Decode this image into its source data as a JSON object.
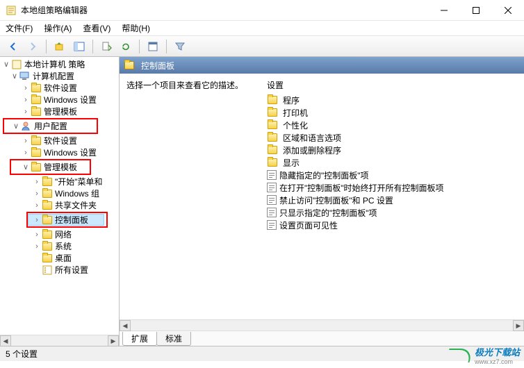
{
  "window": {
    "title": "本地组策略编辑器"
  },
  "menu": {
    "file": "文件(F)",
    "action": "操作(A)",
    "view": "查看(V)",
    "help": "帮助(H)"
  },
  "tree": {
    "root": "本地计算机 策略",
    "computer_config": "计算机配置",
    "cc_software": "软件设置",
    "cc_windows": "Windows 设置",
    "cc_admin": "管理模板",
    "user_config": "用户配置",
    "uc_software": "软件设置",
    "uc_windows": "Windows 设置",
    "uc_admin": "管理模板",
    "uc_startmenu": "\"开始\"菜单和",
    "uc_wincomp": "Windows 组",
    "uc_shared": "共享文件夹",
    "uc_control_panel": "控制面板",
    "uc_network": "网络",
    "uc_system": "系统",
    "uc_desktop": "桌面",
    "uc_all": "所有设置"
  },
  "content": {
    "header": "控制面板",
    "description": "选择一个项目来查看它的描述。",
    "settings_header": "设置",
    "items_folders": [
      "程序",
      "打印机",
      "个性化",
      "区域和语言选项",
      "添加或删除程序",
      "显示"
    ],
    "items_policies": [
      "隐藏指定的\"控制面板\"项",
      "在打开\"控制面板\"时始终打开所有控制面板项",
      "禁止访问\"控制面板\"和 PC 设置",
      "只显示指定的\"控制面板\"项",
      "设置页面可见性"
    ]
  },
  "tabs": {
    "extended": "扩展",
    "standard": "标准"
  },
  "status": {
    "count": "5 个设置"
  },
  "watermark": {
    "name": "极光下载站",
    "url": "www.xz7.com"
  }
}
